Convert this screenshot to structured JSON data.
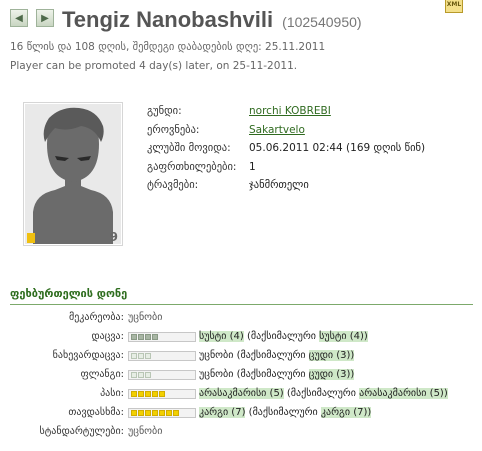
{
  "header": {
    "prev_arrow": "◀",
    "next_arrow": "▶",
    "player_name": "Tengiz Nanobashvili",
    "player_id": "(102540950)",
    "xml_icon": "xml-icon",
    "age_line": "16 წლის და 108 დღის, შემდეგი დაბადების დღე: 25.11.2011",
    "promote_line": "Player can be promoted 4 day(s) later, on 25-11-2011."
  },
  "avatar": {
    "number": "9"
  },
  "details": [
    {
      "label": "გუნდი:",
      "value": "norchi KOBREBI",
      "link": true
    },
    {
      "label": "ეროვნება:",
      "value": "Sakartvelo",
      "link": true
    },
    {
      "label": "კლუბში მოვიდა:",
      "value": "05.06.2011 02:44 (169 დღის წინ)",
      "link": false
    },
    {
      "label": "გაფრთხილებები:",
      "value": "1",
      "link": false
    },
    {
      "label": "ტრავმები:",
      "value": "ჯანმრთელი",
      "link": false
    }
  ],
  "section_title": "ფეხბურთელის დონე",
  "skills": [
    {
      "label": "მეკარეობა:",
      "unknown": "უცნობი",
      "bar": null
    },
    {
      "label": "დაცვა:",
      "bar": {
        "filled": 4,
        "total": 4,
        "color": "green"
      },
      "level": "სუსტი (4)",
      "max_prefix": "(მაქსიმალური",
      "max_level": "სუსტი (4))"
    },
    {
      "label": "ნახევარდაცვა:",
      "bar": {
        "filled": 0,
        "total": 3,
        "color": "green"
      },
      "level": "უცნობი",
      "max_prefix": "(მაქსიმალური",
      "max_level": "ცუდი (3))",
      "level_plain": true
    },
    {
      "label": "ფლანგი:",
      "bar": {
        "filled": 0,
        "total": 3,
        "color": "green"
      },
      "level": "უცნობი",
      "max_prefix": "(მაქსიმალური",
      "max_level": "ცუდი (3))",
      "level_plain": true
    },
    {
      "label": "პასი:",
      "bar": {
        "filled": 5,
        "total": 5,
        "color": "yellow"
      },
      "level": "არასაკმარისი (5)",
      "max_prefix": "(მაქსიმალური",
      "max_level": "არასაკმარისი (5))"
    },
    {
      "label": "თავდასხმა:",
      "bar": {
        "filled": 7,
        "total": 7,
        "color": "yellow"
      },
      "level": "კარგი (7)",
      "max_prefix": "(მაქსიმალური",
      "max_level": "კარგი (7))"
    },
    {
      "label": "სტანდარტულები:",
      "unknown": "უცნობი",
      "bar": null
    }
  ],
  "colors": {
    "accent_green": "#2e6d1e",
    "highlight": "#cfe8c8",
    "bar_yellow": "#f2d000"
  }
}
